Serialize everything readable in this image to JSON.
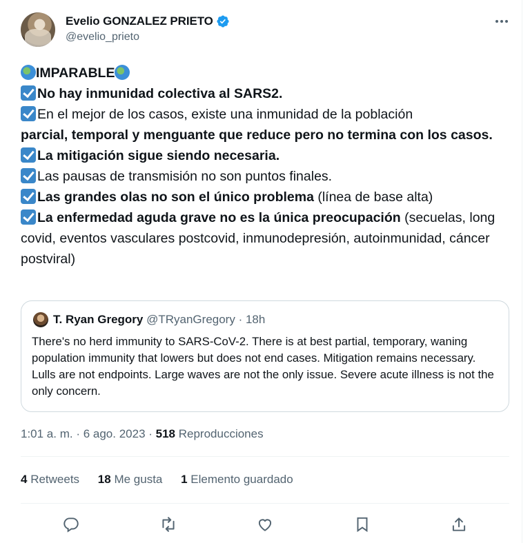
{
  "author": {
    "display_name": "Evelio GONZALEZ PRIETO",
    "handle": "@evelio_prieto"
  },
  "tweet": {
    "title": "IMPARABLE",
    "line1": "No hay inmunidad colectiva al SARS2.",
    "line2a": "En el mejor de los casos, existe una inmunidad de la población",
    "line2b": "parcial, temporal y menguante que reduce pero no termina con los casos.",
    "line3": "La mitigación sigue siendo necesaria.",
    "line4": "Las pausas de transmisión no son puntos finales.",
    "line5_bold": "Las grandes olas no son el único problema",
    "line5_rest": " (línea de base alta)",
    "line6_bold": "La enfermedad aguda grave no es la única preocupación",
    "line6_rest": " (secuelas, long covid, eventos vasculares postcovid, inmunodepresión, autoinmunidad, cáncer postviral)"
  },
  "quote": {
    "name": "T. Ryan Gregory",
    "handle": "@TRyanGregory",
    "separator": " · ",
    "time": "18h",
    "text": "There's no herd immunity to SARS-CoV-2. There is at best partial, temporary, waning population immunity that lowers but does not end cases. Mitigation remains necessary. Lulls are not endpoints. Large waves are not the only issue. Severe acute illness is not the only concern."
  },
  "meta": {
    "time": "1:01 a. m.",
    "sep1": " · ",
    "date": "6 ago. 2023",
    "sep2": " · ",
    "views_count": "518",
    "views_label": " Reproducciones"
  },
  "stats": {
    "retweets_count": "4",
    "retweets_label": " Retweets",
    "likes_count": "18",
    "likes_label": " Me gusta",
    "bookmarks_count": "1",
    "bookmarks_label": " Elemento guardado"
  },
  "colors": {
    "text": "#0f1419",
    "secondary": "#536471",
    "verified": "#1d9bf0",
    "border": "#cfd9de"
  },
  "icons": [
    "verified-badge-icon",
    "more-icon",
    "reply-icon",
    "retweet-icon",
    "like-icon",
    "bookmark-icon",
    "share-icon",
    "globe-emoji-icon",
    "check-emoji-icon"
  ]
}
